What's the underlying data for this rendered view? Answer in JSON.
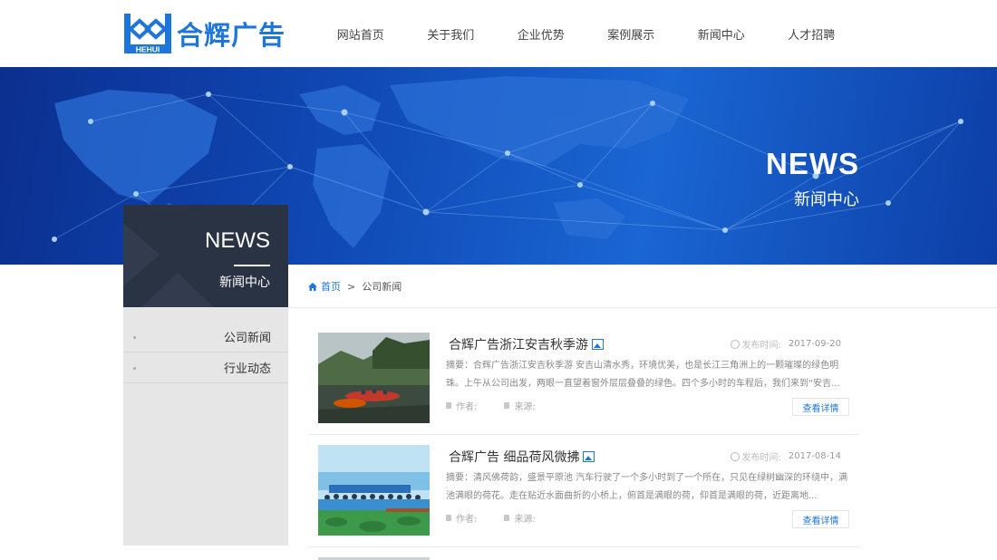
{
  "brand": {
    "name": "合辉广告",
    "sub": "HEHUI",
    "color": "#1e77d8"
  },
  "nav": [
    "网站首页",
    "关于我们",
    "企业优势",
    "案例展示",
    "新闻中心",
    "人才招聘"
  ],
  "banner": {
    "title_en": "NEWS",
    "title_cn": "新闻中心"
  },
  "sidebar": {
    "title_en": "NEWS",
    "title_cn": "新闻中心",
    "items": [
      "公司新闻",
      "行业动态"
    ]
  },
  "breadcrumb": {
    "home": "首页",
    "separator": ">",
    "current": "公司新闻"
  },
  "labels": {
    "date_label": "发布时间:",
    "author_label": "作者:",
    "source_label": "来源:",
    "details": "查看详情"
  },
  "news": [
    {
      "title": "合辉广告浙江安吉秋季游",
      "date": "2017-09-20",
      "summary": "摘要：合辉广告浙江安吉秋季游  安吉山清水秀，环境优美，也是长江三角洲上的一颗璀璨的绿色明珠。上午从公司出发，两眼一直望着窗外层层叠叠的绿色。四个多小时的车程后，我们来到“安吉..."
    },
    {
      "title": "合辉广告 细品荷风微拂",
      "date": "2017-08-14",
      "summary": "摘要：清风佛荷韵，盛景平原池     汽车行驶了一个多小时到了一个所在，只见在绿树幽深的环绕中，满池满眼的荷花。走在贴近水面曲折的小桥上，俯首是满眼的荷，仰首是满眼的荷，近距离地..."
    }
  ],
  "icons": [
    "logo-icon",
    "home-icon",
    "image-icon",
    "clock-icon",
    "user-icon",
    "source-icon"
  ]
}
